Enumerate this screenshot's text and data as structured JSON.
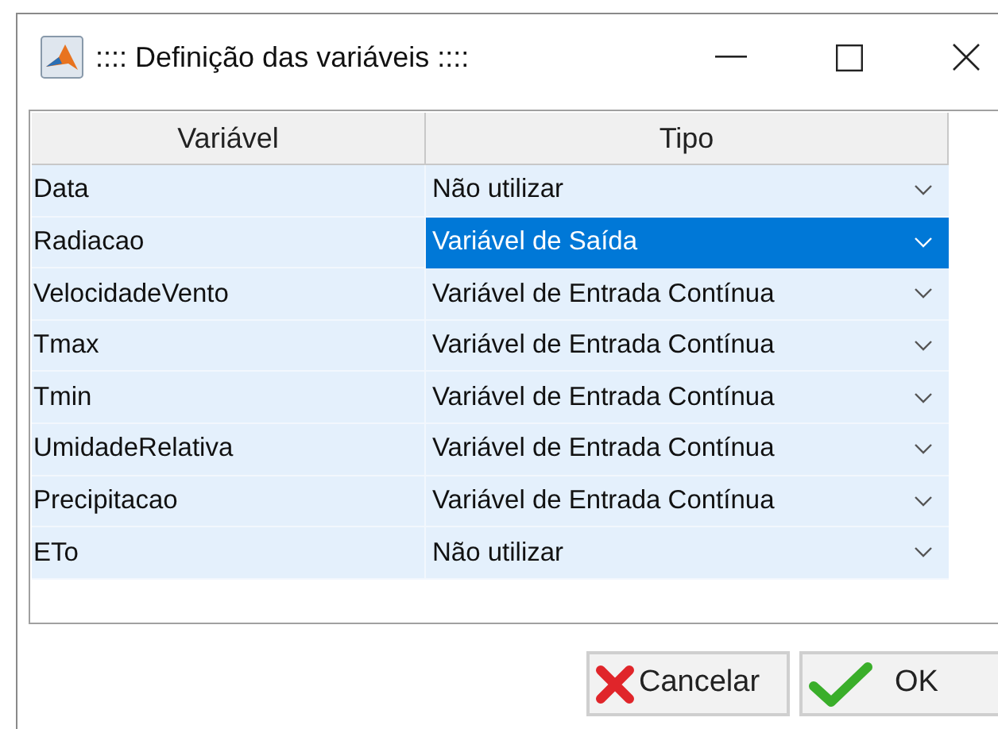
{
  "window": {
    "title": ":::: Definição das variáveis ::::"
  },
  "table": {
    "columns": [
      "Variável",
      "Tipo"
    ],
    "rows": [
      {
        "name": "Data",
        "type": "Não utilizar",
        "selected": false
      },
      {
        "name": "Radiacao",
        "type": "Variável de Saída",
        "selected": true
      },
      {
        "name": "VelocidadeVento",
        "type": "Variável de Entrada Contínua",
        "selected": false
      },
      {
        "name": "Tmax",
        "type": "Variável de Entrada Contínua",
        "selected": false
      },
      {
        "name": "Tmin",
        "type": "Variável de Entrada Contínua",
        "selected": false
      },
      {
        "name": "UmidadeRelativa",
        "type": "Variável de Entrada Contínua",
        "selected": false
      },
      {
        "name": "Precipitacao",
        "type": "Variável de Entrada Contínua",
        "selected": false
      },
      {
        "name": "ETo",
        "type": "Não utilizar",
        "selected": false
      }
    ]
  },
  "buttons": [
    {
      "kind": "cancel",
      "label": "Cancelar"
    },
    {
      "kind": "ok",
      "label": "OK"
    }
  ]
}
